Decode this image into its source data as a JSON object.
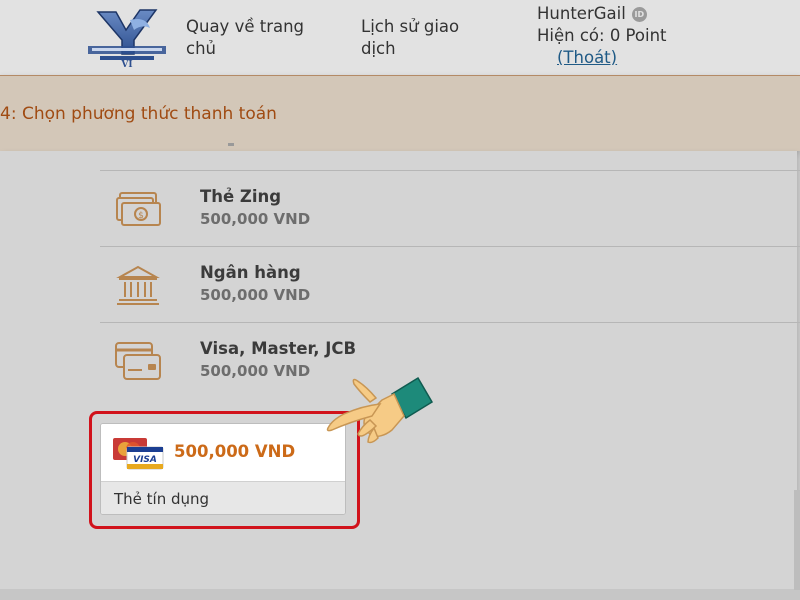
{
  "header": {
    "nav_home": "Quay về trang chủ",
    "nav_history": "Lịch sử giao dịch",
    "username": "HunterGail",
    "id_badge": "ID",
    "balance": "Hiện có: 0 Point",
    "logout": "(Thoát)"
  },
  "step": {
    "title": "4: Chọn phương thức thanh toán"
  },
  "methods": [
    {
      "name": "Thẻ Zing",
      "price": "500,000 VND",
      "icon": "money-card-icon"
    },
    {
      "name": "Ngân hàng",
      "price": "500,000 VND",
      "icon": "bank-icon"
    },
    {
      "name": "Visa, Master, JCB",
      "price": "500,000 VND",
      "icon": "credit-card-icon"
    }
  ],
  "selected_option": {
    "price": "500,000 VND",
    "label": "Thẻ tín dụng",
    "icon": "mastercard-visa-icon"
  },
  "colors": {
    "accent_orange": "#cc6a18",
    "banner_text": "#a04b12",
    "highlight_red": "#d1121b",
    "icon_tan": "#b7854f"
  }
}
